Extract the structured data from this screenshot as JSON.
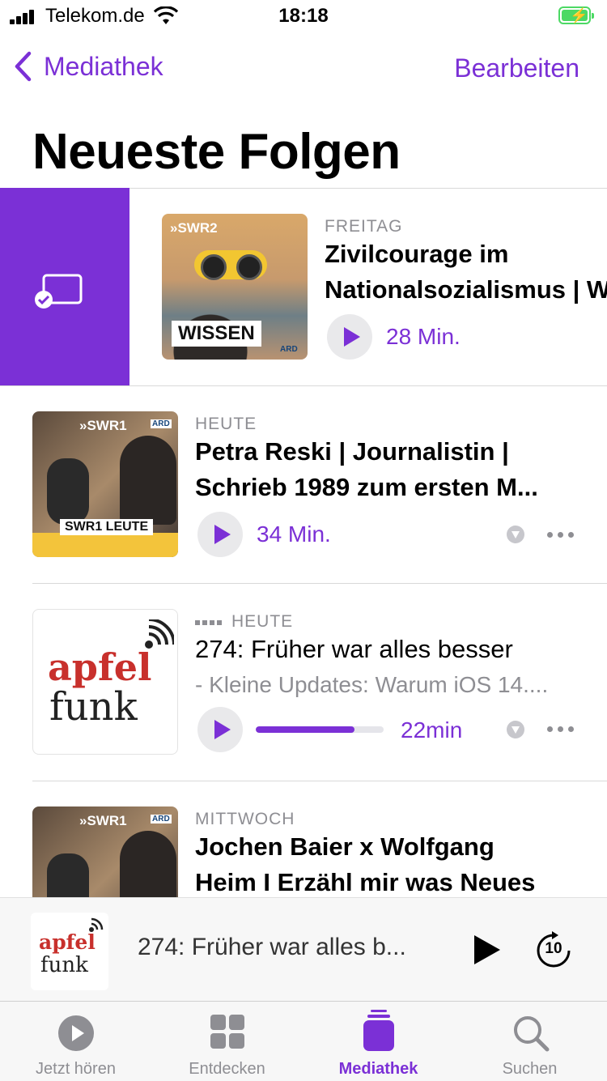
{
  "status_bar": {
    "carrier": "Telekom.de",
    "time": "18:18"
  },
  "nav": {
    "back_label": "Mediathek",
    "edit_label": "Bearbeiten"
  },
  "page_title": "Neueste Folgen",
  "episodes": [
    {
      "date": "FREITAG",
      "title_line1": "Zivilcourage im",
      "title_line2": "Nationalsozialismus | W",
      "duration": "28 Min.",
      "artwork": {
        "brand": "»SWR2",
        "label": "WISSEN",
        "network": "ARD"
      }
    },
    {
      "date": "HEUTE",
      "title_line1": "Petra Reski | Journalistin |",
      "title_line2": "Schrieb 1989 zum ersten M...",
      "duration": "34 Min.",
      "artwork": {
        "brand": "»SWR1",
        "label": "SWR1 LEUTE",
        "network": "ARD"
      }
    },
    {
      "date": "HEUTE",
      "title_line1": "274: Früher war alles besser",
      "subtitle": "- Kleine Updates: Warum iOS 14....",
      "duration": "22min",
      "progress": 0.77,
      "artwork": {
        "line1": "apfel",
        "line2": "funk"
      }
    },
    {
      "date": "MITTWOCH",
      "title_line1": "Jochen Baier x Wolfgang",
      "title_line2": "Heim I Erzähl mir was Neues",
      "artwork": {
        "brand": "»SWR1",
        "network": "ARD"
      }
    }
  ],
  "mini_player": {
    "title": "274: Früher war alles b...",
    "artwork": {
      "line1": "apfel",
      "line2": "funk"
    },
    "skip_seconds": "10"
  },
  "tabs": [
    {
      "label": "Jetzt hören",
      "icon": "play-circle-icon"
    },
    {
      "label": "Entdecken",
      "icon": "grid-icon"
    },
    {
      "label": "Mediathek",
      "icon": "library-icon",
      "active": true
    },
    {
      "label": "Suchen",
      "icon": "search-icon"
    }
  ],
  "colors": {
    "accent": "#7b30d6",
    "secondary_text": "#8e8e93",
    "battery": "#4cd964"
  }
}
